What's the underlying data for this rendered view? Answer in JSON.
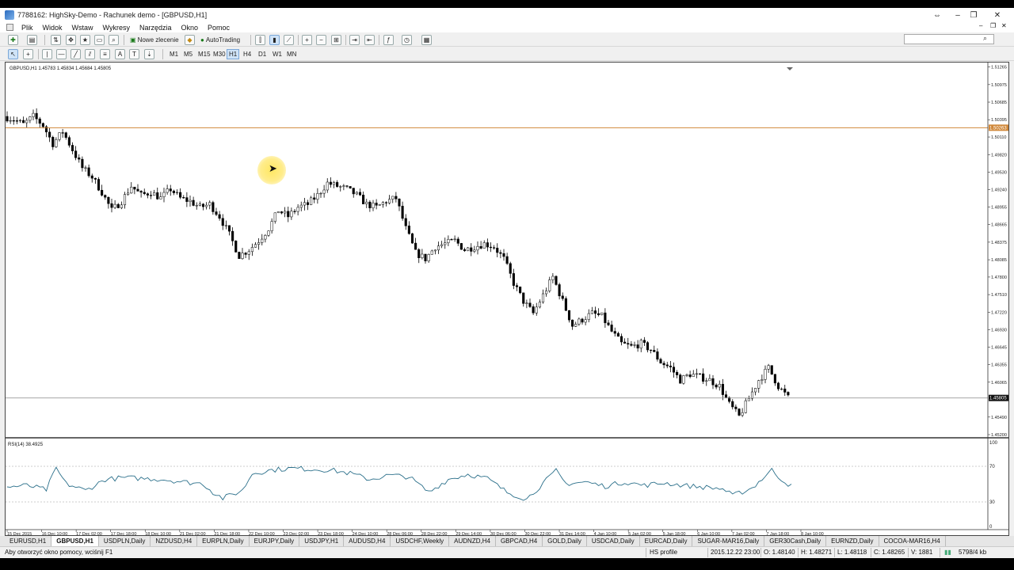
{
  "window": {
    "title": "7788162: HighSky-Demo - Rachunek demo - [GBPUSD,H1]",
    "controls": [
      "⇔",
      "–",
      "❐",
      "✕"
    ],
    "doc_controls": [
      "–",
      "❐",
      "✕"
    ]
  },
  "menu": [
    "Plik",
    "Widok",
    "Wstaw",
    "Wykresy",
    "Narzędzia",
    "Okno",
    "Pomoc"
  ],
  "toolbar": {
    "new_order": "Nowe zlecenie",
    "autotrading": "AutoTrading",
    "search_icon": "search-icon"
  },
  "timeframes": [
    "M1",
    "M5",
    "M15",
    "M30",
    "H1",
    "H4",
    "D1",
    "W1",
    "MN"
  ],
  "active_timeframe": "H1",
  "chart": {
    "info": "GBPUSD,H1  1.45783 1.45834 1.45684 1.45805",
    "current_price_label": "1.45805",
    "hline_price_label": "1.50263",
    "hline_color": "#d0883a",
    "rsi_label": "RSI(14) 38.4925",
    "rsi_color": "#2a6f8a",
    "rsi_levels": [
      "100",
      "70",
      "30",
      "0"
    ]
  },
  "chart_data": {
    "type": "candlestick",
    "symbol": "GBPUSD",
    "timeframe": "H1",
    "ylim": [
      1.452,
      1.5126
    ],
    "y_ticks": [
      "1.51265",
      "1.50975",
      "1.50685",
      "1.50395",
      "1.50110",
      "1.49820",
      "1.49530",
      "1.49240",
      "1.48955",
      "1.48665",
      "1.48375",
      "1.48085",
      "1.47800",
      "1.47510",
      "1.47220",
      "1.46930",
      "1.46645",
      "1.46355",
      "1.46065",
      "1.45490",
      "1.45200"
    ],
    "x_ticks": [
      "15 Dec 2015",
      "16 Dec 10:00",
      "17 Dec 02:00",
      "17 Dec 18:00",
      "18 Dec 10:00",
      "21 Dec 02:00",
      "21 Dec 18:00",
      "22 Dec 10:00",
      "23 Dec 02:00",
      "23 Dec 18:00",
      "24 Dec 10:00",
      "28 Dec 06:00",
      "28 Dec 22:00",
      "29 Dec 14:00",
      "30 Dec 06:00",
      "30 Dec 22:00",
      "31 Dec 14:00",
      "4 Jan 10:00",
      "5 Jan 02:00",
      "5 Jan 18:00",
      "6 Jan 10:00",
      "7 Jan 02:00",
      "7 Jan 18:00",
      "8 Jan 10:00"
    ],
    "close_path": [
      [
        0,
        1.5045
      ],
      [
        3,
        1.504
      ],
      [
        6,
        1.5032
      ],
      [
        9,
        1.5045
      ],
      [
        12,
        1.503
      ],
      [
        15,
        1.5
      ],
      [
        18,
        1.502
      ],
      [
        21,
        1.499
      ],
      [
        24,
        1.496
      ],
      [
        27,
        1.4945
      ],
      [
        30,
        1.492
      ],
      [
        33,
        1.489
      ],
      [
        36,
        1.4905
      ],
      [
        39,
        1.493
      ],
      [
        42,
        1.4915
      ],
      [
        45,
        1.492
      ],
      [
        48,
        1.491
      ],
      [
        51,
        1.4925
      ],
      [
        54,
        1.491
      ],
      [
        57,
        1.4905
      ],
      [
        60,
        1.4895
      ],
      [
        63,
        1.49
      ],
      [
        66,
        1.488
      ],
      [
        69,
        1.485
      ],
      [
        72,
        1.4815
      ],
      [
        75,
        1.4825
      ],
      [
        78,
        1.484
      ],
      [
        81,
        1.486
      ],
      [
        84,
        1.489
      ],
      [
        87,
        1.488
      ],
      [
        90,
        1.4895
      ],
      [
        93,
        1.49
      ],
      [
        96,
        1.4915
      ],
      [
        99,
        1.4935
      ],
      [
        102,
        1.493
      ],
      [
        105,
        1.4925
      ],
      [
        108,
        1.4915
      ],
      [
        111,
        1.49
      ],
      [
        114,
        1.4895
      ],
      [
        117,
        1.4905
      ],
      [
        120,
        1.491
      ],
      [
        123,
        1.486
      ],
      [
        126,
        1.482
      ],
      [
        129,
        1.481
      ],
      [
        132,
        1.483
      ],
      [
        135,
        1.4835
      ],
      [
        138,
        1.484
      ],
      [
        141,
        1.4825
      ],
      [
        144,
        1.483
      ],
      [
        147,
        1.4835
      ],
      [
        150,
        1.483
      ],
      [
        153,
        1.481
      ],
      [
        156,
        1.477
      ],
      [
        159,
        1.474
      ],
      [
        162,
        1.472
      ],
      [
        165,
        1.475
      ],
      [
        168,
        1.478
      ],
      [
        171,
        1.474
      ],
      [
        174,
        1.47
      ],
      [
        177,
        1.471
      ],
      [
        180,
        1.472
      ],
      [
        183,
        1.4715
      ],
      [
        186,
        1.469
      ],
      [
        189,
        1.467
      ],
      [
        192,
        1.4665
      ],
      [
        195,
        1.467
      ],
      [
        198,
        1.466
      ],
      [
        201,
        1.464
      ],
      [
        204,
        1.463
      ],
      [
        207,
        1.461
      ],
      [
        210,
        1.462
      ],
      [
        213,
        1.4615
      ],
      [
        216,
        1.461
      ],
      [
        219,
        1.46
      ],
      [
        222,
        1.457
      ],
      [
        225,
        1.455
      ],
      [
        228,
        1.458
      ],
      [
        231,
        1.461
      ],
      [
        234,
        1.463
      ],
      [
        237,
        1.46
      ],
      [
        240,
        1.4581
      ]
    ],
    "rsi_path": [
      [
        0,
        46
      ],
      [
        6,
        48
      ],
      [
        12,
        43
      ],
      [
        15,
        68
      ],
      [
        18,
        50
      ],
      [
        24,
        42
      ],
      [
        30,
        55
      ],
      [
        36,
        57
      ],
      [
        42,
        56
      ],
      [
        48,
        55
      ],
      [
        54,
        52
      ],
      [
        60,
        50
      ],
      [
        63,
        40
      ],
      [
        66,
        33
      ],
      [
        72,
        42
      ],
      [
        75,
        62
      ],
      [
        81,
        66
      ],
      [
        87,
        68
      ],
      [
        93,
        67
      ],
      [
        99,
        66
      ],
      [
        105,
        62
      ],
      [
        111,
        55
      ],
      [
        117,
        60
      ],
      [
        123,
        58
      ],
      [
        129,
        40
      ],
      [
        135,
        55
      ],
      [
        141,
        61
      ],
      [
        147,
        56
      ],
      [
        153,
        40
      ],
      [
        159,
        32
      ],
      [
        165,
        54
      ],
      [
        168,
        65
      ],
      [
        171,
        50
      ],
      [
        177,
        52
      ],
      [
        183,
        47
      ],
      [
        189,
        52
      ],
      [
        195,
        48
      ],
      [
        201,
        51
      ],
      [
        207,
        48
      ],
      [
        213,
        46
      ],
      [
        219,
        44
      ],
      [
        222,
        36
      ],
      [
        228,
        45
      ],
      [
        234,
        66
      ],
      [
        237,
        55
      ],
      [
        240,
        47
      ]
    ],
    "grid": false
  },
  "tabs": [
    "EURUSD,H1",
    "GBPUSD,H1",
    "USDPLN,Daily",
    "NZDUSD,H4",
    "EURPLN,Daily",
    "EURJPY,Daily",
    "USDJPY,H1",
    "AUDUSD,H4",
    "USDCHF,Weekly",
    "AUDNZD,H4",
    "GBPCAD,H4",
    "GOLD,Daily",
    "USDCAD,Daily",
    "EURCAD,Daily",
    "SUGAR-MAR16,Daily",
    "GER30Cash,Daily",
    "EURNZD,Daily",
    "COCOA-MAR16,H4"
  ],
  "active_tab": "GBPUSD,H1",
  "status": {
    "help": "Aby otworzyć okno pomocy, wciśnij F1",
    "profile": "HS profile",
    "datetime": "2015.12.22 23:00",
    "open": "O: 1.48140",
    "high": "H: 1.48271",
    "low": "L: 1.48118",
    "close": "C: 1.48265",
    "volume": "V: 1881",
    "traffic": "5798/4 kb"
  }
}
